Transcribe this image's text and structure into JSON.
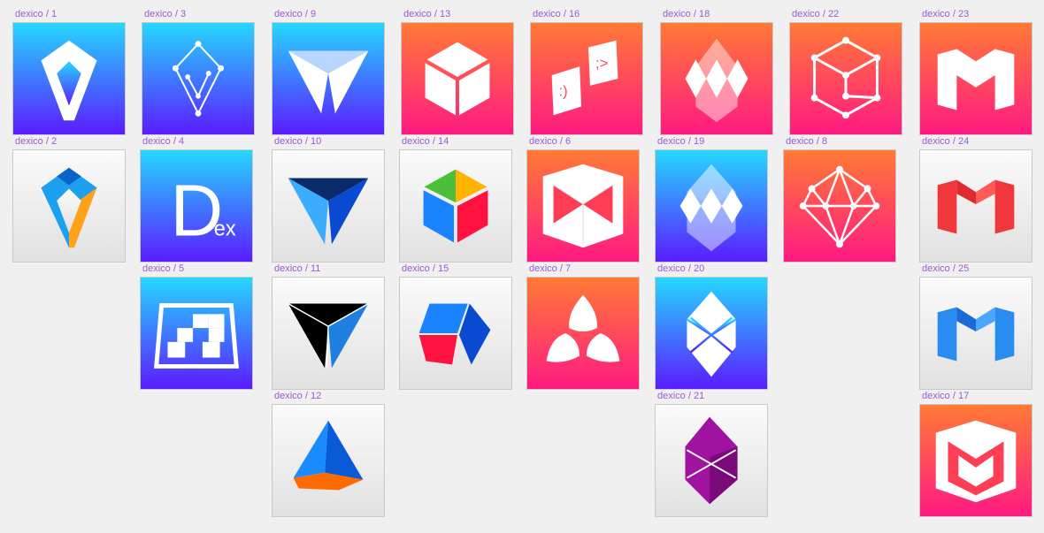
{
  "canvas": {
    "background": "#f0f0f0",
    "label_color": "#9b59d6"
  },
  "gradients": {
    "blue": [
      "#25d7ff",
      "#5a1cff"
    ],
    "orange": [
      "#ff7a35",
      "#ff1a82"
    ],
    "gray": [
      "#fbfbfb",
      "#e1e1e1"
    ]
  },
  "frames": [
    {
      "id": "d1",
      "label": "dexico / 1",
      "bg": "blue",
      "icon": "diamond-v-icon"
    },
    {
      "id": "d2",
      "label": "dexico / 2",
      "bg": "gray",
      "icon": "diamond-v-color-icon"
    },
    {
      "id": "d3",
      "label": "dexico / 3",
      "bg": "blue",
      "icon": "kite-v-nodes-icon"
    },
    {
      "id": "d4",
      "label": "dexico / 4",
      "bg": "blue",
      "icon": "dex-letter-icon",
      "letter": "D",
      "sub": "ex"
    },
    {
      "id": "d5",
      "label": "dexico / 5",
      "bg": "blue",
      "icon": "checker-trapezoid-icon"
    },
    {
      "id": "d9",
      "label": "dexico / 9",
      "bg": "blue",
      "icon": "triangle-prism-icon"
    },
    {
      "id": "d10",
      "label": "dexico / 10",
      "bg": "gray",
      "icon": "triangle-prism-blue-icon"
    },
    {
      "id": "d11",
      "label": "dexico / 11",
      "bg": "gray",
      "icon": "triangle-prism-black-icon"
    },
    {
      "id": "d12",
      "label": "dexico / 12",
      "bg": "gray",
      "icon": "pyramid-icon"
    },
    {
      "id": "d13",
      "label": "dexico / 13",
      "bg": "orange",
      "icon": "cube-icon"
    },
    {
      "id": "d14",
      "label": "dexico / 14",
      "bg": "gray",
      "icon": "cube-color-icon"
    },
    {
      "id": "d15",
      "label": "dexico / 15",
      "bg": "gray",
      "icon": "cube-tilted-icon"
    },
    {
      "id": "d16",
      "label": "dexico / 16",
      "bg": "orange",
      "icon": "chat-cards-icon",
      "left_text": ":)",
      "right_text": ";>"
    },
    {
      "id": "d6",
      "label": "dexico / 6",
      "bg": "orange",
      "icon": "bowtie-box-icon"
    },
    {
      "id": "d7",
      "label": "dexico / 7",
      "bg": "orange",
      "icon": "reuleaux-trio-icon"
    },
    {
      "id": "d18",
      "label": "dexico / 18",
      "bg": "orange",
      "icon": "crystal-icon"
    },
    {
      "id": "d19",
      "label": "dexico / 19",
      "bg": "blue",
      "icon": "crystal-blue-icon"
    },
    {
      "id": "d20",
      "label": "dexico / 20",
      "bg": "blue",
      "icon": "crystal-x-icon"
    },
    {
      "id": "d21",
      "label": "dexico / 21",
      "bg": "gray",
      "icon": "crystal-purple-icon"
    },
    {
      "id": "d22",
      "label": "dexico / 22",
      "bg": "orange",
      "icon": "cube-wireframe-icon"
    },
    {
      "id": "d8",
      "label": "dexico / 8",
      "bg": "orange",
      "icon": "gem-network-icon"
    },
    {
      "id": "d23",
      "label": "dexico / 23",
      "bg": "orange",
      "icon": "m-letter-icon"
    },
    {
      "id": "d24",
      "label": "dexico / 24",
      "bg": "gray",
      "icon": "m-letter-red-icon"
    },
    {
      "id": "d25",
      "label": "dexico / 25",
      "bg": "gray",
      "icon": "m-letter-blue-icon"
    },
    {
      "id": "d17",
      "label": "dexico / 17",
      "bg": "orange",
      "icon": "m-box-icon"
    }
  ]
}
